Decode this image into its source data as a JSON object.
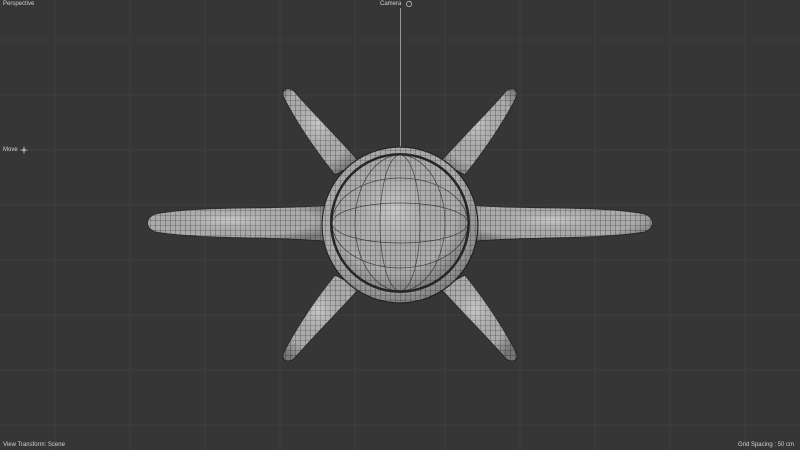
{
  "viewport": {
    "mode_label": "Perspective",
    "camera_label": "Camera",
    "camera_icon": "camera-rotate-icon",
    "move_label": "Move",
    "move_icon": "move-crosshair-icon",
    "view_transform": "View Transform: Scene",
    "grid_spacing": "Grid Spacing : 50 cm"
  },
  "colors": {
    "background": "#363636",
    "grid_line": "#3e3e3e",
    "mesh_fill": "#b9b9b9",
    "mesh_wire": "#2c2c2c",
    "mesh_dark": "#8a8a8a"
  }
}
